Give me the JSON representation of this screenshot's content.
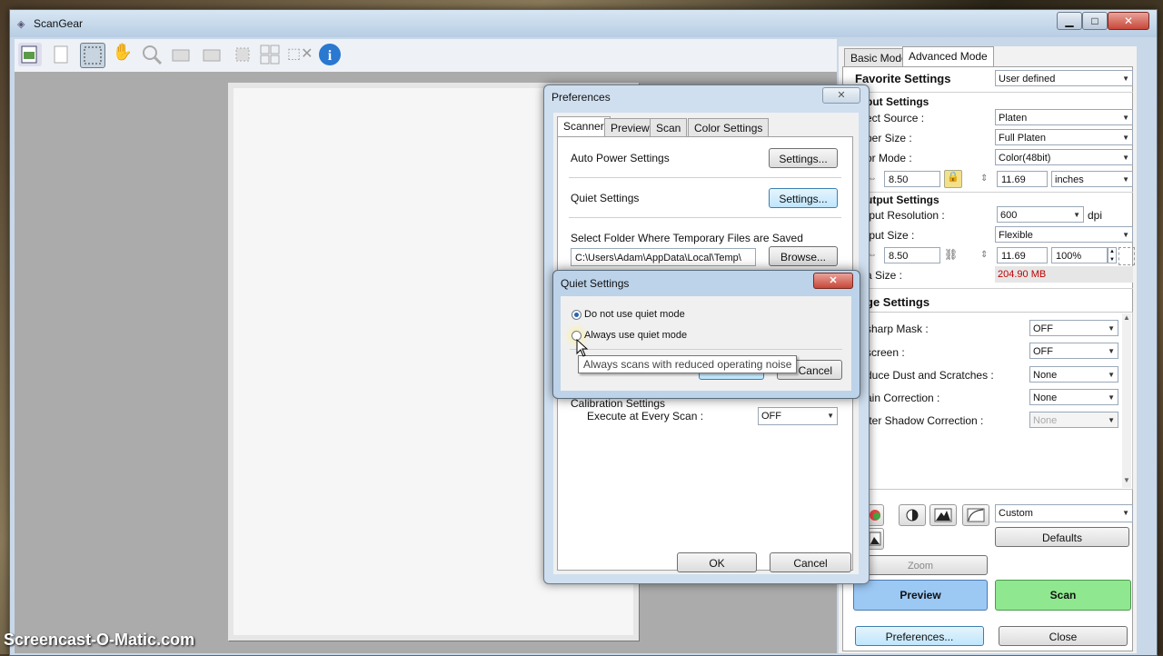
{
  "app": {
    "title": "ScanGear"
  },
  "window_controls": {
    "minimize": "▁",
    "maximize": "□",
    "close": "✕"
  },
  "tabs": {
    "basic": "Basic Mode",
    "advanced": "Advanced Mode"
  },
  "panel": {
    "favorite_label": "Favorite Settings",
    "favorite_value": "User defined",
    "input_settings": "put Settings",
    "select_source_label": "ect Source :",
    "select_source_value": "Platen",
    "paper_size_label": "per Size :",
    "paper_size_value": "Full Platen",
    "color_mode_label": "or Mode :",
    "color_mode_value": "Color(48bit)",
    "input_width": "8.50",
    "input_height": "11.69",
    "units": "inches",
    "output_settings": "utput Settings",
    "output_res_label": "tput Resolution :",
    "output_res_value": "600",
    "dpi": "dpi",
    "output_size_label": "tput Size :",
    "output_size_value": "Flexible",
    "output_width": "8.50",
    "output_height": "11.69",
    "scale": "100%",
    "data_size_label": "a Size :",
    "data_size_value": "204.90 MB",
    "image_settings": "ge Settings",
    "unsharp_label": "sharp Mask :",
    "unsharp_value": "OFF",
    "descreen_label": "screen :",
    "descreen_value": "OFF",
    "dust_label": "duce Dust and Scratches :",
    "dust_value": "None",
    "grain_label": "ain Correction :",
    "grain_value": "None",
    "shadow_label": "tter Shadow Correction :",
    "shadow_value": "None",
    "tone_value": "Custom",
    "defaults": "Defaults",
    "zoom": "Zoom",
    "preview": "Preview",
    "scan": "Scan",
    "preferences": "Preferences...",
    "close": "Close"
  },
  "prefs": {
    "title": "Preferences",
    "close_x": "✕",
    "tabs": [
      "Scanner",
      "Preview",
      "Scan",
      "Color Settings"
    ],
    "auto_power_label": "Auto Power Settings",
    "settings_btn": "Settings...",
    "quiet_label": "Quiet Settings",
    "folder_label": "Select Folder Where Temporary Files are Saved",
    "folder_value": "C:\\Users\\Adam\\AppData\\Local\\Temp\\",
    "browse": "Browse...",
    "calibration_label": "Calibration Settings",
    "execute_label": "Execute at Every Scan :",
    "execute_value": "OFF",
    "ok": "OK",
    "cancel": "Cancel"
  },
  "quiet": {
    "title": "Quiet Settings",
    "close_x": "✕",
    "option1": "Do not use quiet mode",
    "option2": "Always use quiet mode",
    "cancel": "Cancel",
    "tooltip": "Always scans with reduced operating noise"
  },
  "watermark": "Screencast-O-Matic.com",
  "colors": {
    "preview_button": "#9cc8f4",
    "scan_button": "#8fe88f",
    "data_size": "#c00000"
  }
}
